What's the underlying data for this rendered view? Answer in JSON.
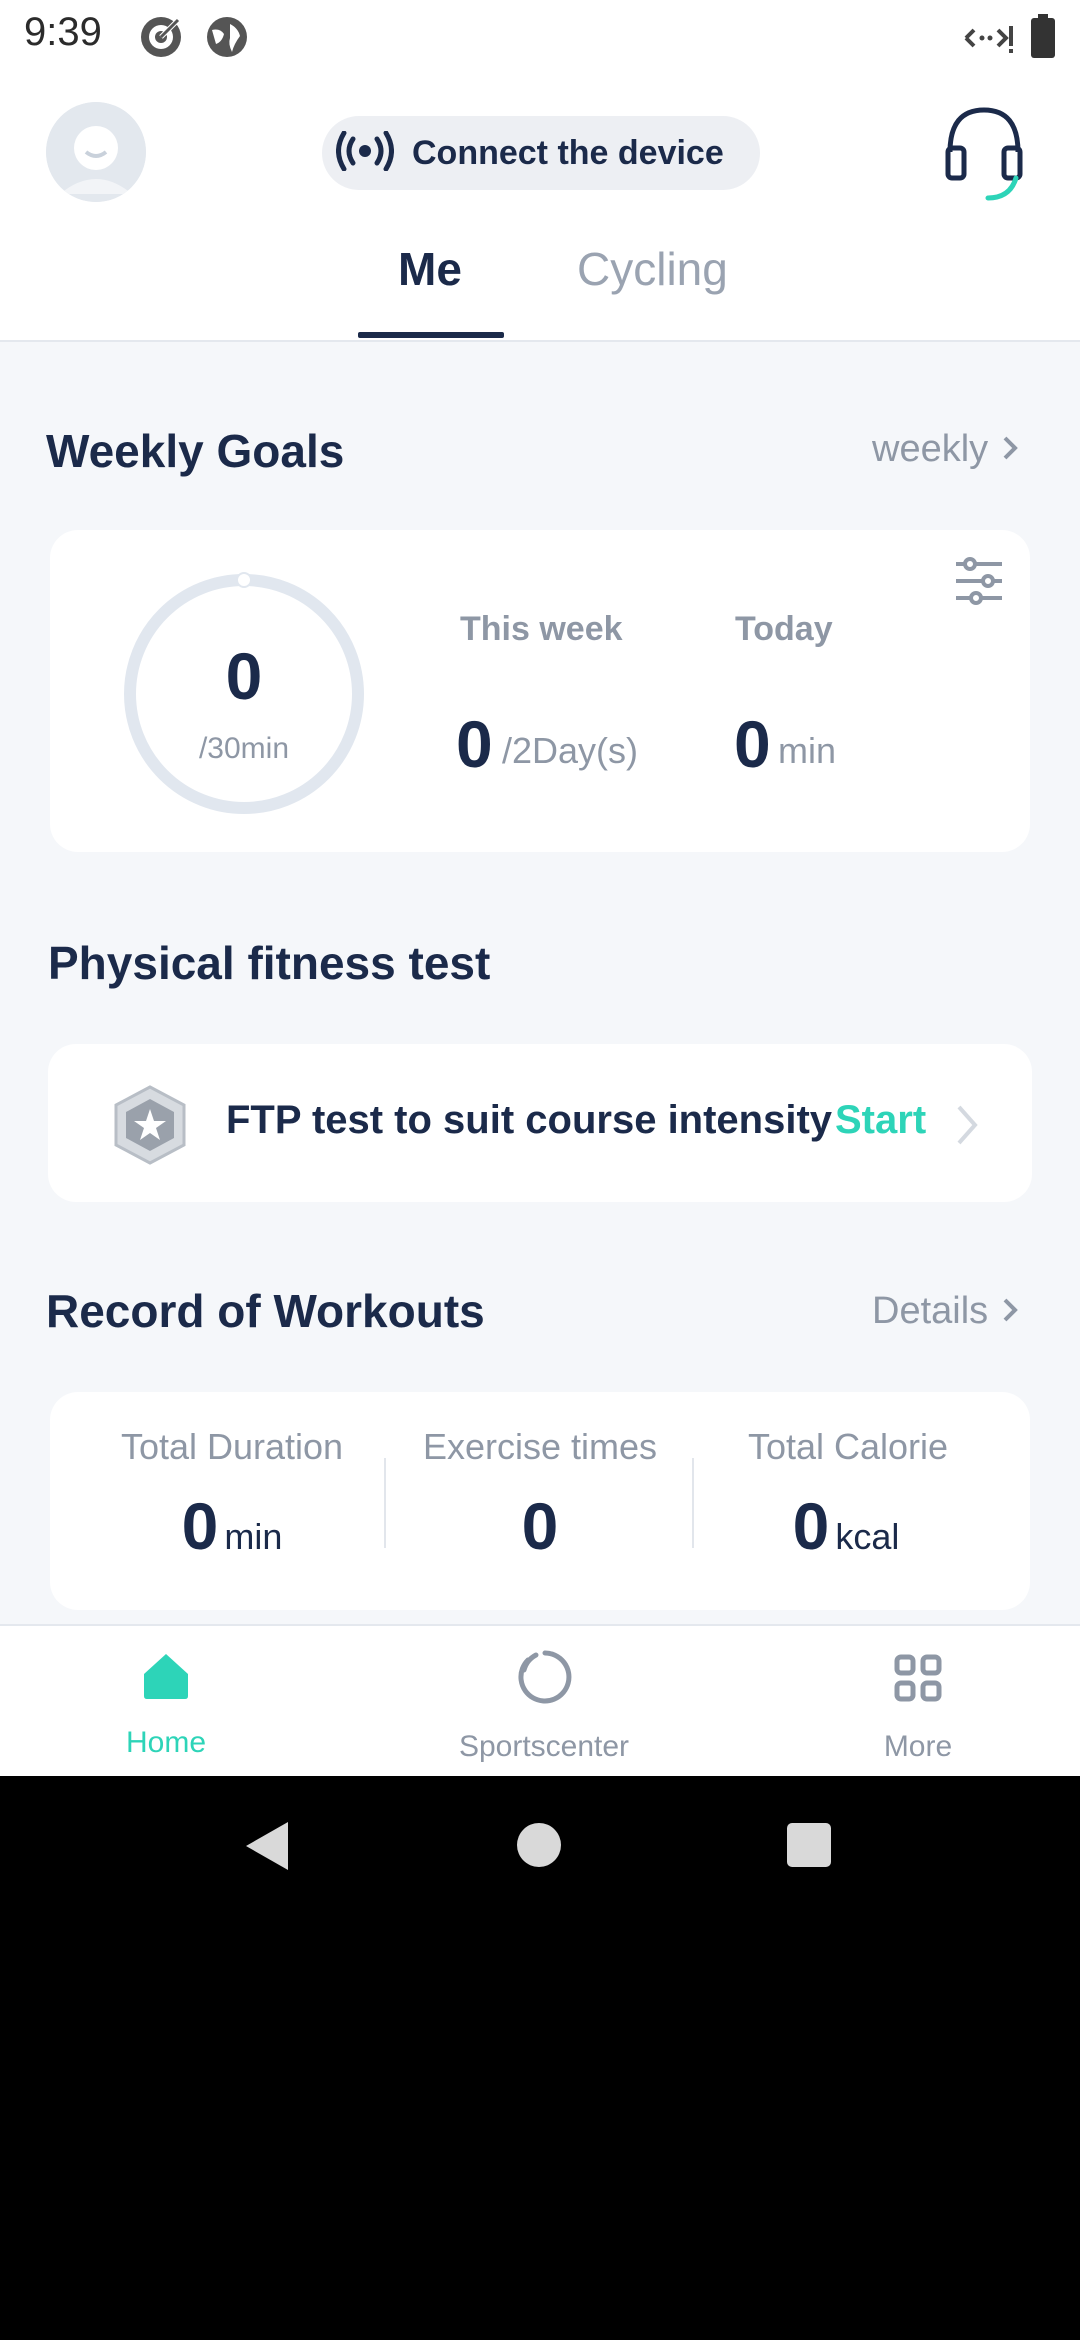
{
  "status_bar": {
    "time": "9:39"
  },
  "header": {
    "connect_label": "Connect the device",
    "tabs": [
      {
        "label": "Me",
        "active": true
      },
      {
        "label": "Cycling",
        "active": false
      }
    ]
  },
  "weekly_goals": {
    "title": "Weekly Goals",
    "link": "weekly",
    "ring_value": "0",
    "ring_target": "/30min",
    "progress_fraction": 0,
    "this_week_label": "This week",
    "this_week_value": "0",
    "this_week_unit": "/2Day(s)",
    "today_label": "Today",
    "today_value": "0",
    "today_unit": "min"
  },
  "fitness_test": {
    "title": "Physical fitness test",
    "ftp_text": "FTP test to suit course intensity",
    "start_label": "Start"
  },
  "workouts": {
    "title": "Record of Workouts",
    "link": "Details",
    "stats": [
      {
        "label": "Total Duration",
        "value": "0",
        "unit": "min"
      },
      {
        "label": "Exercise times",
        "value": "0",
        "unit": ""
      },
      {
        "label": "Total Calorie",
        "value": "0",
        "unit": "kcal"
      }
    ]
  },
  "bottom_nav": [
    {
      "label": "Home",
      "active": true,
      "icon": "home-icon"
    },
    {
      "label": "Sportscenter",
      "active": false,
      "icon": "sportscenter-icon"
    },
    {
      "label": "More",
      "active": false,
      "icon": "grid-icon"
    }
  ],
  "colors": {
    "accent": "#2dd4b8",
    "primary_text": "#1b2a4a",
    "muted_text": "#8e97a5"
  }
}
